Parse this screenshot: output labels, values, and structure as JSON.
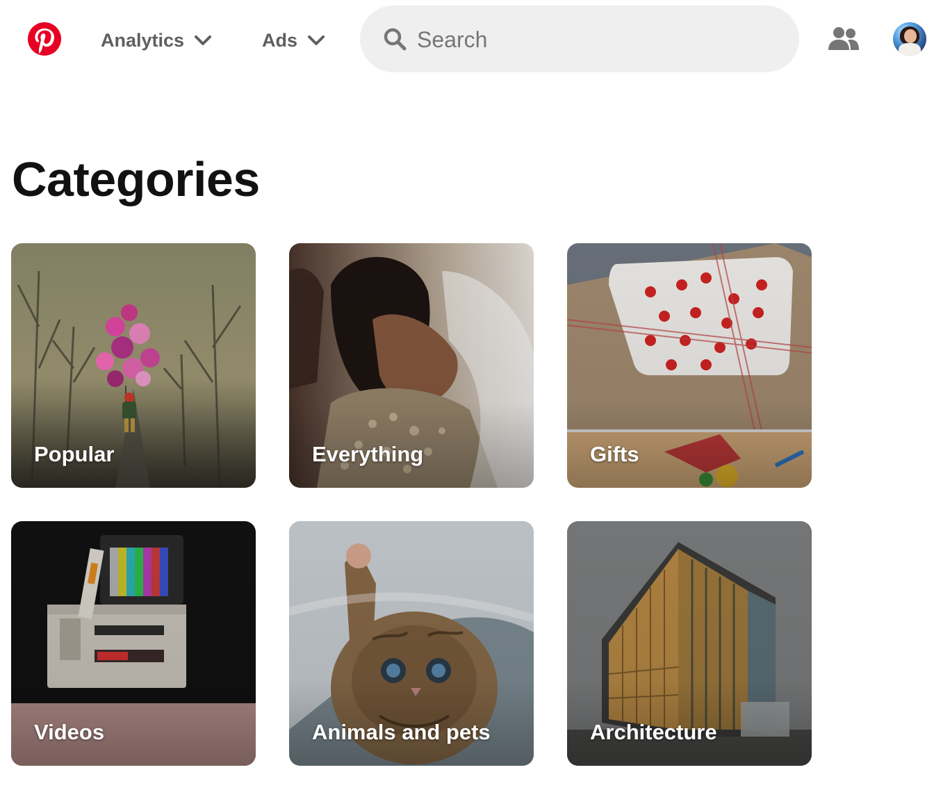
{
  "header": {
    "logo_icon": "pinterest-logo-icon",
    "nav": [
      {
        "label": "Analytics",
        "icon": "chevron-down-icon"
      },
      {
        "label": "Ads",
        "icon": "chevron-down-icon"
      }
    ],
    "search": {
      "placeholder": "Search",
      "value": "",
      "icon": "search-icon"
    },
    "people_icon": "people-icon",
    "avatar_icon": "avatar"
  },
  "main": {
    "title": "Categories",
    "categories": [
      {
        "label": "Popular"
      },
      {
        "label": "Everything"
      },
      {
        "label": "Gifts"
      },
      {
        "label": "Videos"
      },
      {
        "label": "Animals and pets"
      },
      {
        "label": "Architecture"
      }
    ]
  },
  "colors": {
    "brand": "#e60023",
    "nav_text": "#5f5f5f",
    "search_bg": "#efefef",
    "title_text": "#111111"
  }
}
